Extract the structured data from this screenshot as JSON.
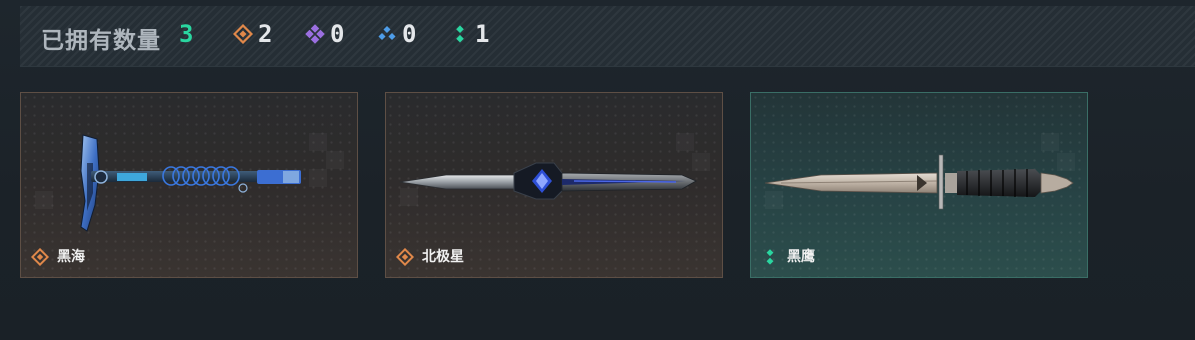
{
  "header": {
    "title": "已拥有数量",
    "total": "3",
    "stats": [
      {
        "icon": "orange-diamond-rarity-icon",
        "color": "#e0884a",
        "count": "2"
      },
      {
        "icon": "purple-diamond-rarity-icon",
        "color": "#9b6fe0",
        "count": "0"
      },
      {
        "icon": "blue-diamond-rarity-icon",
        "color": "#4e9de8",
        "count": "0"
      },
      {
        "icon": "green-diamond-rarity-icon",
        "color": "#2ad6a0",
        "count": "1"
      }
    ]
  },
  "cards": [
    {
      "name": "黑海",
      "rarity": "orange",
      "weapon_icon": "axe-icon"
    },
    {
      "name": "北极星",
      "rarity": "orange",
      "weapon_icon": "dagger-icon"
    },
    {
      "name": "黑鹰",
      "rarity": "green",
      "weapon_icon": "combat-knife-icon"
    }
  ],
  "colors": {
    "orange": "#e0884a",
    "purple": "#9b6fe0",
    "blue": "#4e9de8",
    "green": "#2ad6a0"
  }
}
